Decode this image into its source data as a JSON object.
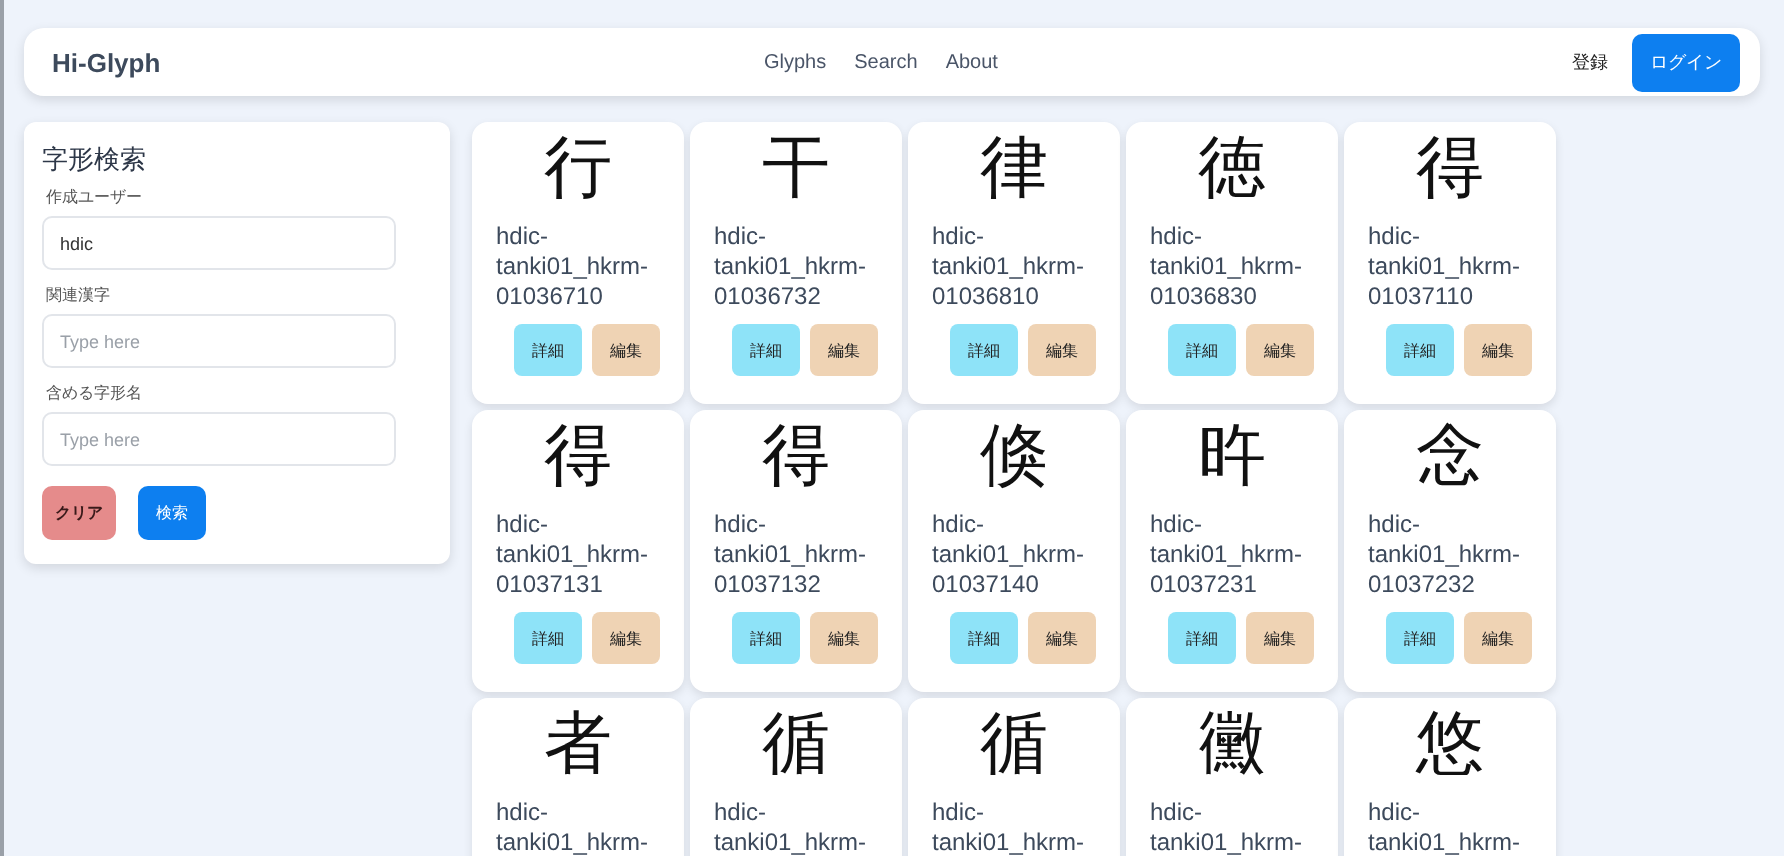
{
  "navbar": {
    "brand": "Hi-Glyph",
    "links": [
      "Glyphs",
      "Search",
      "About"
    ],
    "register": "登録",
    "login": "ログイン"
  },
  "search_panel": {
    "title": "字形検索",
    "fields": [
      {
        "label": "作成ユーザー",
        "value": "hdic"
      },
      {
        "label": "関連漢字",
        "placeholder": "Type here"
      },
      {
        "label": "含める字形名",
        "placeholder": "Type here"
      }
    ],
    "clear_button": "クリア",
    "search_button": "検索"
  },
  "glyphs": [
    {
      "glyph": "行",
      "name": "hdic-tanki01_hkrm-01036710",
      "detail": "詳細",
      "edit": "編集"
    },
    {
      "glyph": "干",
      "name": "hdic-tanki01_hkrm-01036732",
      "detail": "詳細",
      "edit": "編集"
    },
    {
      "glyph": "律",
      "name": "hdic-tanki01_hkrm-01036810",
      "detail": "詳細",
      "edit": "編集"
    },
    {
      "glyph": "徳",
      "name": "hdic-tanki01_hkrm-01036830",
      "detail": "詳細",
      "edit": "編集"
    },
    {
      "glyph": "得",
      "name": "hdic-tanki01_hkrm-01037110",
      "detail": "詳細",
      "edit": "編集"
    },
    {
      "glyph": "得",
      "name": "hdic-tanki01_hkrm-01037131",
      "detail": "詳細",
      "edit": "編集"
    },
    {
      "glyph": "得",
      "name": "hdic-tanki01_hkrm-01037132",
      "detail": "詳細",
      "edit": "編集"
    },
    {
      "glyph": "倏",
      "name": "hdic-tanki01_hkrm-01037140",
      "detail": "詳細",
      "edit": "編集"
    },
    {
      "glyph": "旿",
      "name": "hdic-tanki01_hkrm-01037231",
      "detail": "詳細",
      "edit": "編集"
    },
    {
      "glyph": "念",
      "name": "hdic-tanki01_hkrm-01037232",
      "detail": "詳細",
      "edit": "編集"
    },
    {
      "glyph": "者",
      "name": "hdic-tanki01_hkrm-"
    },
    {
      "glyph": "循",
      "name": "hdic-tanki01_hkrm-"
    },
    {
      "glyph": "循",
      "name": "hdic-tanki01_hkrm-"
    },
    {
      "glyph": "黴",
      "name": "hdic-tanki01_hkrm-"
    },
    {
      "glyph": "悠",
      "name": "hdic-tanki01_hkrm-"
    }
  ]
}
